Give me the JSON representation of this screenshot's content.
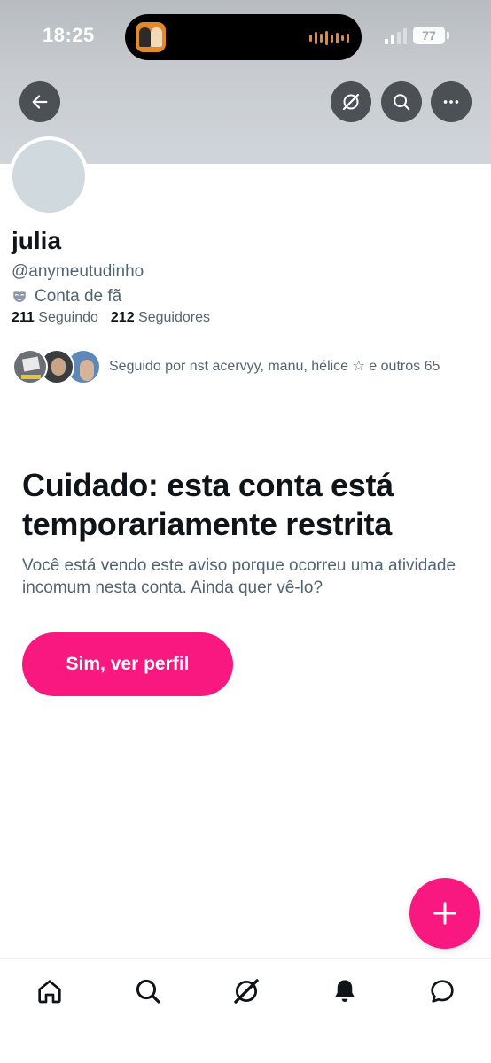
{
  "status_bar": {
    "time": "18:25",
    "battery": "77",
    "icons": [
      "now-playing-app-icon",
      "audio-waveform-icon",
      "cellular-signal-icon",
      "battery-icon"
    ]
  },
  "header": {
    "back_icon": "arrow-left-icon",
    "actions": [
      "grok-icon",
      "search-icon",
      "more-icon"
    ]
  },
  "profile": {
    "name": "julia",
    "handle": "@anymeutudinho",
    "badge_icon": "fan-mask-icon",
    "badge_label": "Conta de fã",
    "following_count": "211",
    "following_label": "Seguindo",
    "followers_count": "212",
    "followers_label": "Seguidores",
    "followed_by_text": "Seguido por nst acervyy, manu, hélice ☆ e outros 65"
  },
  "warning": {
    "title": "Cuidado: esta conta está temporariamente restrita",
    "body": "Você está vendo este aviso porque ocorreu uma atividade incomum nesta conta. Ainda quer vê-lo?",
    "button_label": "Sim, ver perfil"
  },
  "fab": {
    "icon": "plus-icon"
  },
  "bottom_nav": [
    "home-icon",
    "search-icon",
    "grok-icon",
    "notifications-bell-icon",
    "messages-icon"
  ],
  "colors": {
    "accent": "#f91880",
    "text_primary": "#0f1419",
    "text_secondary": "#536471",
    "banner": "#c8ccd1",
    "avatar_placeholder": "#cfd9de"
  }
}
